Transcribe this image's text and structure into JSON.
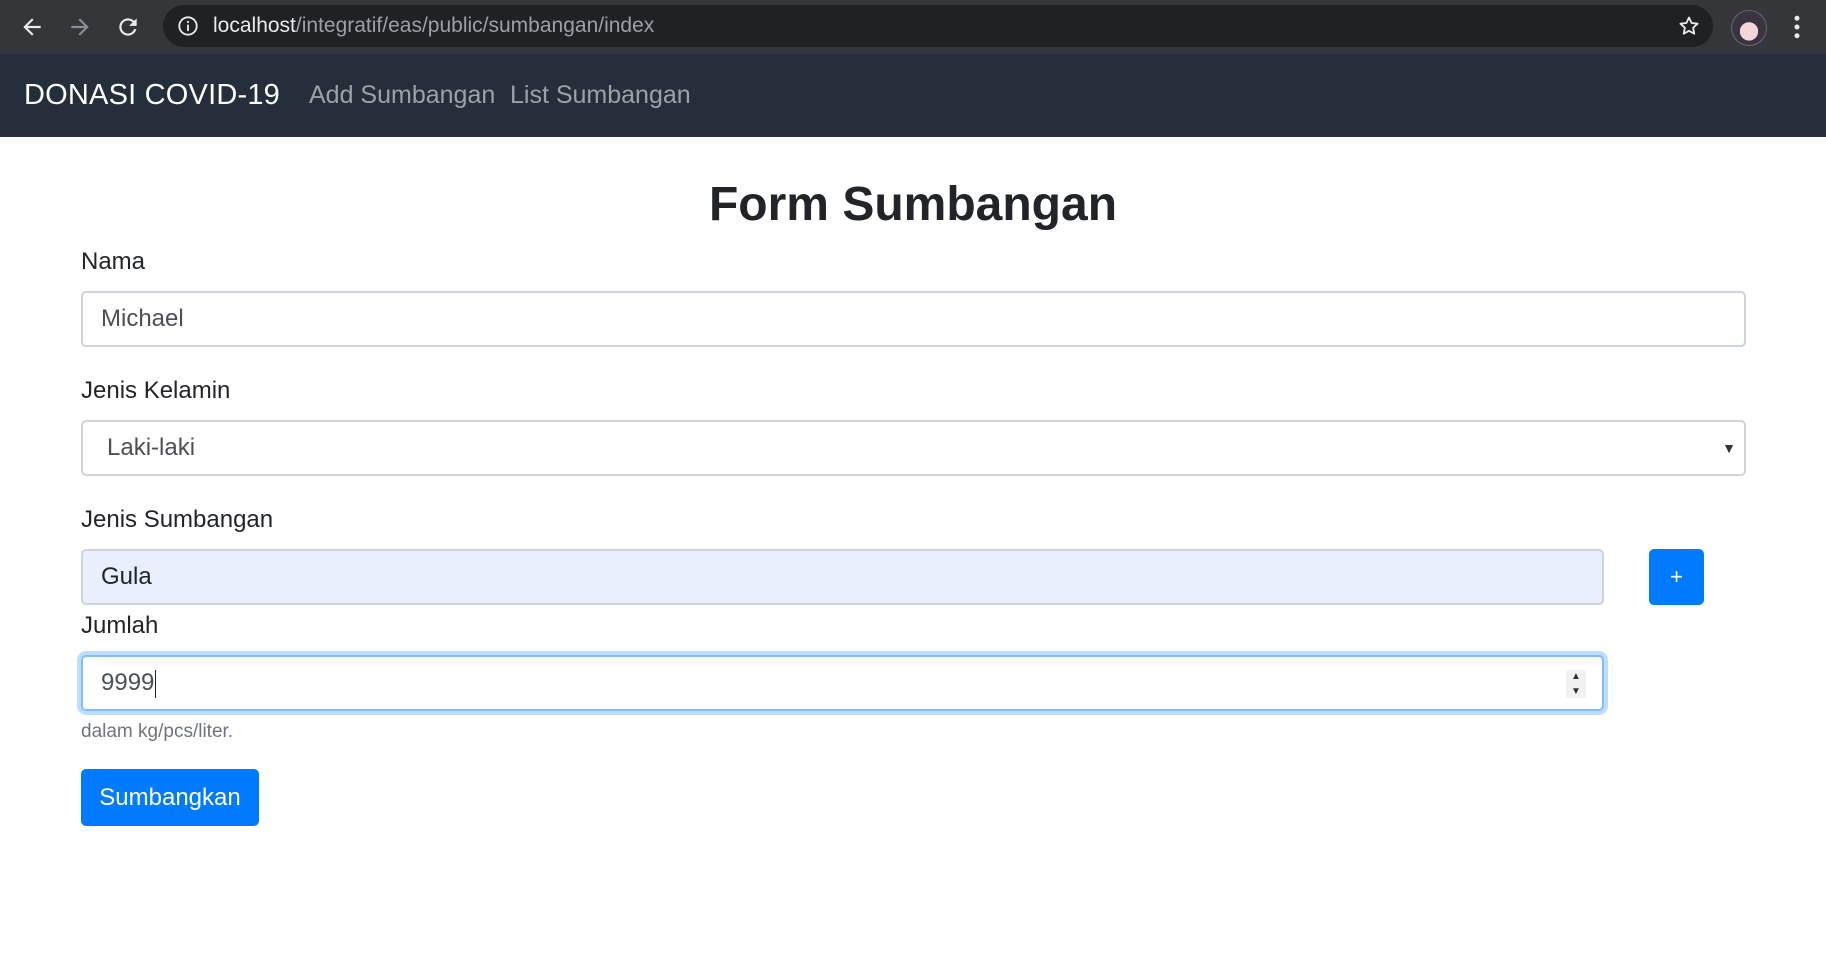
{
  "browser": {
    "url_host": "localhost",
    "url_path": "/integratif/eas/public/sumbangan/index"
  },
  "navbar": {
    "brand": "DONASI COVID-19",
    "links": [
      "Add Sumbangan",
      "List Sumbangan"
    ]
  },
  "form": {
    "title": "Form Sumbangan",
    "nama_label": "Nama",
    "nama_value": "Michael",
    "jenis_kelamin_label": "Jenis Kelamin",
    "jenis_kelamin_value": "Laki-laki",
    "jenis_sumbangan_label": "Jenis Sumbangan",
    "jenis_sumbangan_value": "Gula",
    "add_button_label": "+",
    "jumlah_label": "Jumlah",
    "jumlah_value": "9999",
    "jumlah_help": "dalam kg/pcs/liter.",
    "submit_label": "Sumbangkan"
  },
  "colors": {
    "navbar_bg": "#242f3b",
    "primary": "#007bff",
    "autofill_bg": "#e8f0fe"
  }
}
